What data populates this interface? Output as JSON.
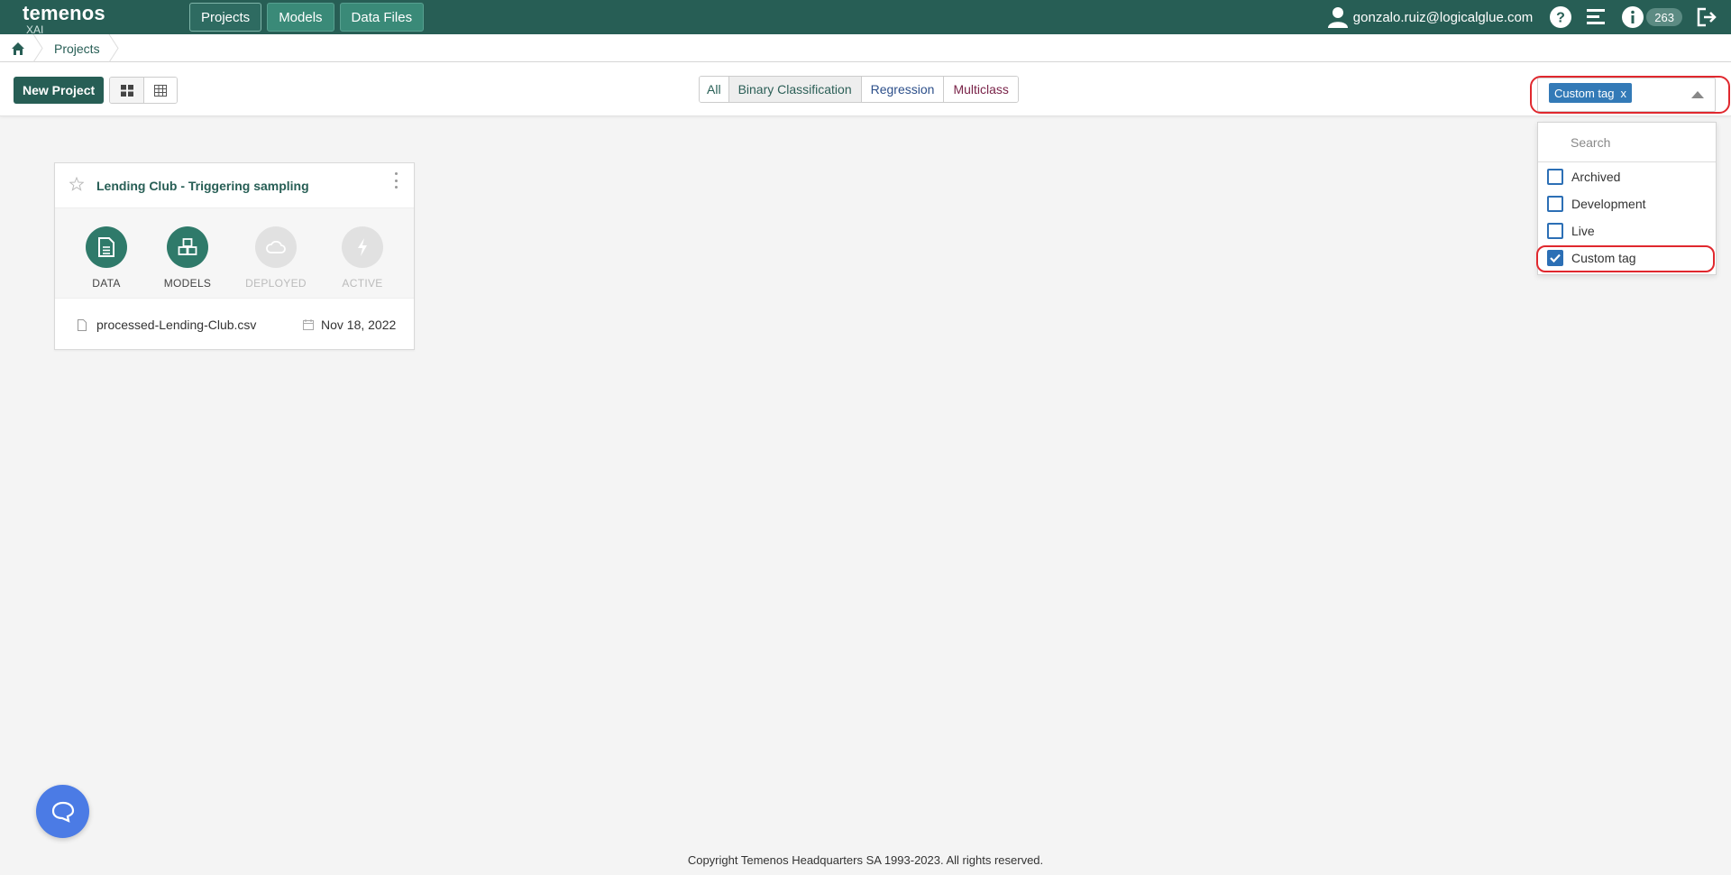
{
  "brand": {
    "name": "temenos",
    "sub": "XAI"
  },
  "nav": {
    "tabs": [
      {
        "label": "Projects"
      },
      {
        "label": "Models"
      },
      {
        "label": "Data Files"
      }
    ],
    "user_email": "gonzalo.ruiz@logicalglue.com",
    "badge_count": "263",
    "icons": [
      "user-icon",
      "help-icon",
      "list-icon",
      "info-icon",
      "logout-icon"
    ]
  },
  "breadcrumb": {
    "current": "Projects",
    "home_icon": "home-icon"
  },
  "toolbar": {
    "new_project_label": "New Project",
    "view_icons": [
      "grid-view-icon",
      "table-view-icon"
    ],
    "filters": [
      "All",
      "Binary Classification",
      "Regression",
      "Multiclass"
    ]
  },
  "tag_select": {
    "selected_chip": "Custom tag",
    "remove_label": "x",
    "search_placeholder": "Search",
    "options": [
      {
        "label": "Archived",
        "checked": false
      },
      {
        "label": "Development",
        "checked": false
      },
      {
        "label": "Live",
        "checked": false
      },
      {
        "label": "Custom tag",
        "checked": true
      }
    ]
  },
  "project_card": {
    "title": "Lending Club - Triggering sampling",
    "stages": [
      {
        "label": "DATA",
        "active": true,
        "icon": "document-icon"
      },
      {
        "label": "MODELS",
        "active": true,
        "icon": "cubes-icon"
      },
      {
        "label": "DEPLOYED",
        "active": false,
        "icon": "cloud-icon"
      },
      {
        "label": "ACTIVE",
        "active": false,
        "icon": "bolt-icon"
      }
    ],
    "file_name": "processed-Lending-Club.csv",
    "date": "Nov 18, 2022"
  },
  "footer": {
    "copyright": "Copyright Temenos Headquarters SA 1993-2023. All rights reserved."
  },
  "colors": {
    "navbar": "#275e55",
    "accent": "#2f7a6a",
    "chip": "#337ab7",
    "highlight": "#e0282e",
    "chat": "#4b7be5"
  }
}
